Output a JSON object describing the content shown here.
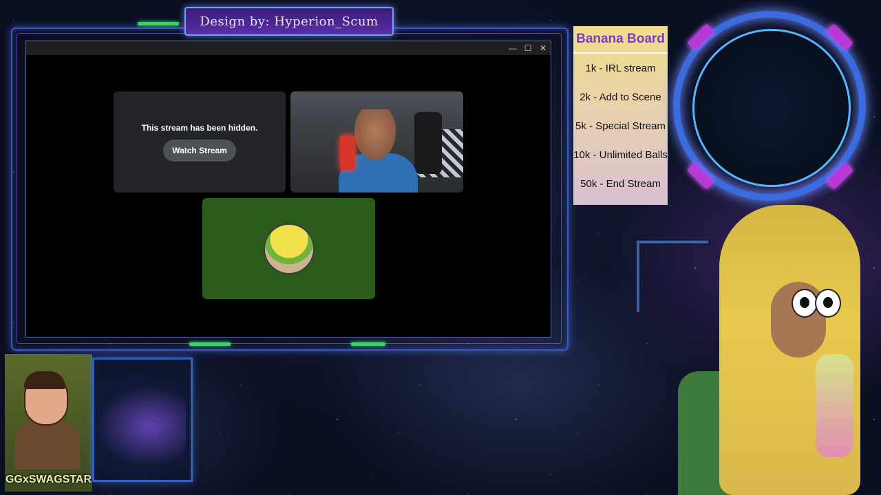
{
  "overlay": {
    "credit": "Design by: Hyperion_Scum"
  },
  "app_window": {
    "controls": {
      "minimize": "—",
      "maximize": "☐",
      "close": "✕"
    },
    "hidden_stream": {
      "message": "This stream has been hidden.",
      "button": "Watch Stream"
    }
  },
  "banana_board": {
    "title": "Banana Board",
    "items": [
      "1k - IRL stream",
      "2k - Add to Scene",
      "5k - Special Stream",
      "10k - Unlimited Balls",
      "50k - End Stream"
    ]
  },
  "logo": {
    "text": "GGxSWAGSTAR"
  },
  "colors": {
    "board_title": "#7b3cc4",
    "avatar_tile": "#2b5a1d",
    "frame_blue": "#3a55c8",
    "accent_green": "#3fd16a"
  }
}
